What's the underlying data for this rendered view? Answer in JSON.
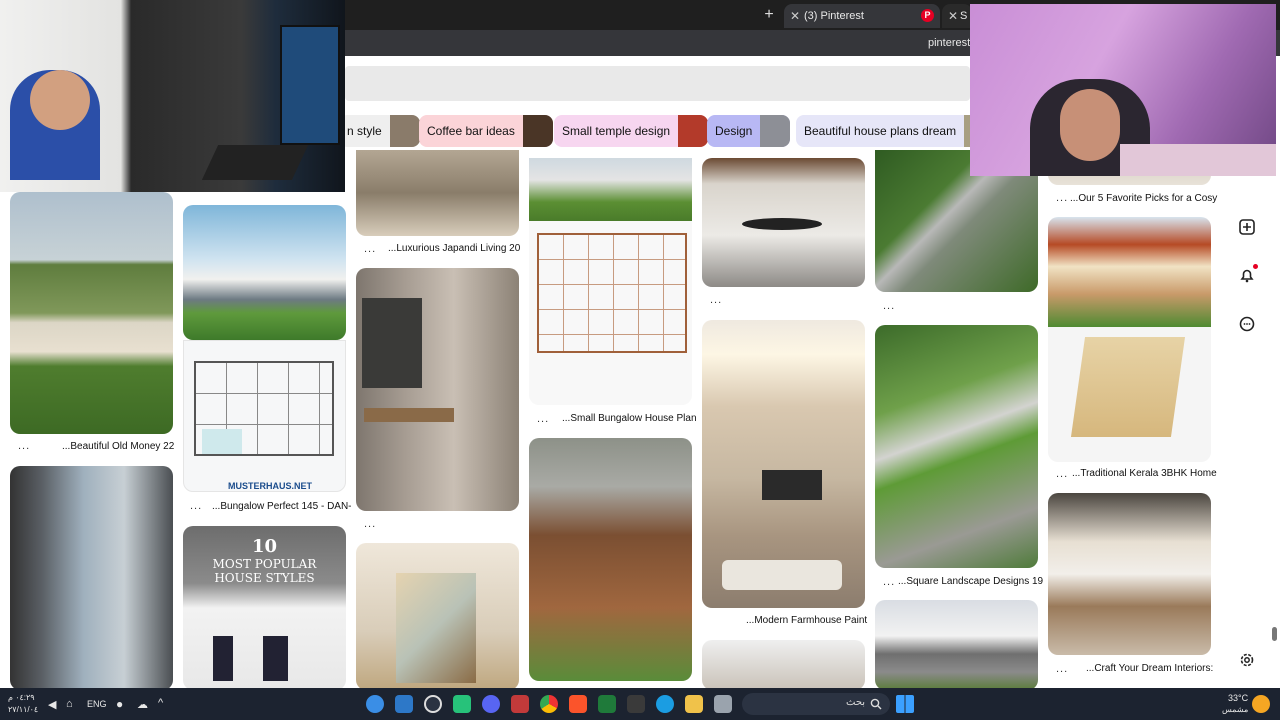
{
  "browser": {
    "new_tab": "+",
    "active_tab": {
      "close": "✕",
      "title": "(3) Pinterest",
      "favicon": "P"
    },
    "second_tab": {
      "close": "✕",
      "title": "S"
    },
    "address": "pinterest."
  },
  "chips": [
    {
      "label": "n style",
      "color": "#efefef",
      "thumb": "#8a7b6a"
    },
    {
      "label": "Coffee bar ideas",
      "color": "#fbd4d8",
      "thumb": "#4a3526"
    },
    {
      "label": "Small temple design",
      "color": "#f7d6f0",
      "thumb": "#b33a2a"
    },
    {
      "label": "Design",
      "color": "#b8b8f4",
      "thumb": "#8d8f96"
    },
    {
      "label": "Beautiful house plans dream",
      "color": "#e6e6f8",
      "thumb": "#a89f82"
    }
  ],
  "pins": {
    "col1_caption": "...Beautiful Old Money 22",
    "col2_caption": "...Bungalow Perfect 145 - DAN-",
    "col2_brand": "MUSTERHAUS.NET",
    "col2_poster_line1": "10",
    "col2_poster_line2": "MOST POPULAR",
    "col2_poster_line3": "HOUSE STYLES",
    "col3_caption": "...Luxurious Japandi Living 20",
    "col4_caption": "...Small Bungalow House Plan",
    "col5_caption": "...Modern Farmhouse Paint",
    "col6_caption": "...Square Landscape Designs 19",
    "col7_caption_top": "...Our 5 Favorite Picks for a Cosy",
    "col7_caption_mid": "...Traditional Kerala 3BHK Home",
    "col7_caption_bottom": "...Craft Your Dream Interiors:",
    "more": "..."
  },
  "rail_icons": [
    "board-icon",
    "add-icon",
    "bell-icon",
    "chat-icon",
    "gear-icon"
  ],
  "taskbar": {
    "clock_time": "٠٤:٢٩ م",
    "clock_date": "٢٧/١١/٠٤",
    "language": "ENG",
    "search_placeholder": "بحث",
    "weather_temp": "33°C",
    "weather_text": "مشمس"
  }
}
